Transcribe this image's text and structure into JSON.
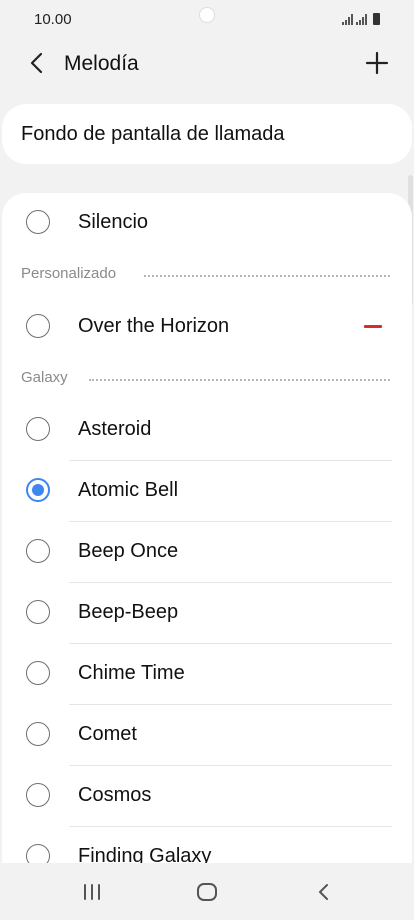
{
  "status_bar": {
    "time": "10.00"
  },
  "header": {
    "title": "Melodía",
    "back_icon": "chevron-left-icon",
    "add_icon": "plus-icon"
  },
  "target": {
    "label": "Fondo de pantalla de llamada"
  },
  "list": {
    "silence": {
      "label": "Silencio",
      "selected": false
    },
    "custom_section": {
      "label": "Personalizado"
    },
    "custom_items": [
      {
        "label": "Over the Horizon",
        "selected": false,
        "remove_icon": "minus-icon"
      }
    ],
    "galaxy_section": {
      "label": "Galaxy"
    },
    "galaxy_items": [
      {
        "label": "Asteroid",
        "selected": false
      },
      {
        "label": "Atomic Bell",
        "selected": true
      },
      {
        "label": "Beep Once",
        "selected": false
      },
      {
        "label": "Beep-Beep",
        "selected": false
      },
      {
        "label": "Chime Time",
        "selected": false
      },
      {
        "label": "Comet",
        "selected": false
      },
      {
        "label": "Cosmos",
        "selected": false
      },
      {
        "label": "Finding Galaxy",
        "selected": false
      }
    ]
  },
  "colors": {
    "accent": "#3e86f2",
    "remove": "#d32f2f",
    "background": "#f2f2f2"
  },
  "nav_bar": {
    "recent_icon": "recent-apps-icon",
    "home_icon": "home-icon",
    "back_icon": "back-icon"
  }
}
